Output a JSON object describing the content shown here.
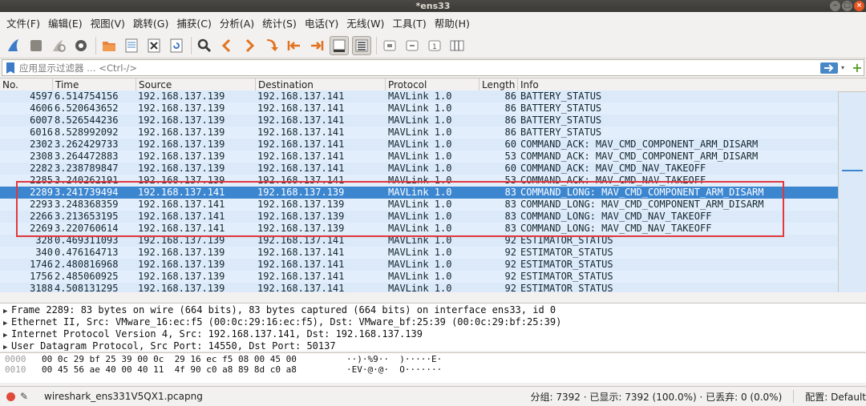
{
  "window": {
    "title": "*ens33"
  },
  "menu": [
    "文件(F)",
    "编辑(E)",
    "视图(V)",
    "跳转(G)",
    "捕获(C)",
    "分析(A)",
    "统计(S)",
    "电话(Y)",
    "无线(W)",
    "工具(T)",
    "帮助(H)"
  ],
  "toolbar_icons": [
    "shark-fin-start-icon",
    "stop-square-icon",
    "restart-fin-icon",
    "gear-options-icon",
    "open-folder-icon",
    "save-file-icon",
    "close-file-icon",
    "reload-icon",
    "find-magnifier-icon",
    "back-arrow-icon",
    "forward-arrow-icon",
    "goto-packet-icon",
    "first-packet-icon",
    "last-packet-icon",
    "autoscroll-icon",
    "colorize-icon",
    "zoom-in-icon",
    "zoom-out-icon",
    "normal-size-icon",
    "resize-columns-icon"
  ],
  "filter": {
    "placeholder": "应用显示过滤器 … <Ctrl-/>"
  },
  "columns": {
    "no": "No.",
    "time": "Time",
    "source": "Source",
    "destination": "Destination",
    "protocol": "Protocol",
    "length": "Length",
    "info": "Info"
  },
  "packets": [
    {
      "no": "4597",
      "time": "6.514754156",
      "source": "192.168.137.139",
      "destination": "192.168.137.141",
      "protocol": "MAVLink 1.0",
      "length": "86",
      "info": "BATTERY_STATUS"
    },
    {
      "no": "4606",
      "time": "6.520643652",
      "source": "192.168.137.139",
      "destination": "192.168.137.141",
      "protocol": "MAVLink 1.0",
      "length": "86",
      "info": "BATTERY_STATUS"
    },
    {
      "no": "6007",
      "time": "8.526544236",
      "source": "192.168.137.139",
      "destination": "192.168.137.141",
      "protocol": "MAVLink 1.0",
      "length": "86",
      "info": "BATTERY_STATUS"
    },
    {
      "no": "6016",
      "time": "8.528992092",
      "source": "192.168.137.139",
      "destination": "192.168.137.141",
      "protocol": "MAVLink 1.0",
      "length": "86",
      "info": "BATTERY_STATUS"
    },
    {
      "no": "2302",
      "time": "3.262429733",
      "source": "192.168.137.139",
      "destination": "192.168.137.141",
      "protocol": "MAVLink 1.0",
      "length": "60",
      "info": "COMMAND_ACK: MAV_CMD_COMPONENT_ARM_DISARM"
    },
    {
      "no": "2308",
      "time": "3.264472883",
      "source": "192.168.137.139",
      "destination": "192.168.137.141",
      "protocol": "MAVLink 1.0",
      "length": "53",
      "info": "COMMAND_ACK: MAV_CMD_COMPONENT_ARM_DISARM"
    },
    {
      "no": "2282",
      "time": "3.238789847",
      "source": "192.168.137.139",
      "destination": "192.168.137.141",
      "protocol": "MAVLink 1.0",
      "length": "60",
      "info": "COMMAND_ACK: MAV_CMD_NAV_TAKEOFF"
    },
    {
      "no": "2285",
      "time": "3.240262191",
      "source": "192.168.137.139",
      "destination": "192.168.137.141",
      "protocol": "MAVLink 1.0",
      "length": "53",
      "info": "COMMAND_ACK: MAV_CMD_NAV_TAKEOFF"
    },
    {
      "no": "2289",
      "time": "3.241739494",
      "source": "192.168.137.141",
      "destination": "192.168.137.139",
      "protocol": "MAVLink 1.0",
      "length": "83",
      "info": "COMMAND_LONG: MAV_CMD_COMPONENT_ARM_DISARM",
      "selected": true
    },
    {
      "no": "2293",
      "time": "3.248368359",
      "source": "192.168.137.141",
      "destination": "192.168.137.139",
      "protocol": "MAVLink 1.0",
      "length": "83",
      "info": "COMMAND_LONG: MAV_CMD_COMPONENT_ARM_DISARM"
    },
    {
      "no": "2266",
      "time": "3.213653195",
      "source": "192.168.137.141",
      "destination": "192.168.137.139",
      "protocol": "MAVLink 1.0",
      "length": "83",
      "info": "COMMAND_LONG: MAV_CMD_NAV_TAKEOFF"
    },
    {
      "no": "2269",
      "time": "3.220760614",
      "source": "192.168.137.141",
      "destination": "192.168.137.139",
      "protocol": "MAVLink 1.0",
      "length": "83",
      "info": "COMMAND_LONG: MAV_CMD_NAV_TAKEOFF"
    },
    {
      "no": "328",
      "time": "0.469311093",
      "source": "192.168.137.139",
      "destination": "192.168.137.141",
      "protocol": "MAVLink 1.0",
      "length": "92",
      "info": "ESTIMATOR_STATUS"
    },
    {
      "no": "340",
      "time": "0.476164713",
      "source": "192.168.137.139",
      "destination": "192.168.137.141",
      "protocol": "MAVLink 1.0",
      "length": "92",
      "info": "ESTIMATOR_STATUS"
    },
    {
      "no": "1746",
      "time": "2.480816968",
      "source": "192.168.137.139",
      "destination": "192.168.137.141",
      "protocol": "MAVLink 1.0",
      "length": "92",
      "info": "ESTIMATOR_STATUS"
    },
    {
      "no": "1756",
      "time": "2.485060925",
      "source": "192.168.137.139",
      "destination": "192.168.137.141",
      "protocol": "MAVLink 1.0",
      "length": "92",
      "info": "ESTIMATOR_STATUS"
    },
    {
      "no": "3188",
      "time": "4.508131295",
      "source": "192.168.137.139",
      "destination": "192.168.137.141",
      "protocol": "MAVLink 1.0",
      "length": "92",
      "info": "ESTIMATOR_STATUS"
    }
  ],
  "details": [
    "Frame 2289: 83 bytes on wire (664 bits), 83 bytes captured (664 bits) on interface ens33, id 0",
    "Ethernet II, Src: VMware_16:ec:f5 (00:0c:29:16:ec:f5), Dst: VMware_bf:25:39 (00:0c:29:bf:25:39)",
    "Internet Protocol Version 4, Src: 192.168.137.141, Dst: 192.168.137.139",
    "User Datagram Protocol, Src Port: 14550, Dst Port: 50137"
  ],
  "bytes": [
    {
      "offset": "0000",
      "hex": "00 0c 29 bf 25 39 00 0c  29 16 ec f5 08 00 45 00",
      "ascii": "··)·%9··  )·····E·"
    },
    {
      "offset": "0010",
      "hex": "00 45 56 ae 40 00 40 11  4f 90 c0 a8 89 8d c0 a8",
      "ascii": "·EV·@·@·  O·······"
    }
  ],
  "status": {
    "file": "wireshark_ens331V5QX1.pcapng",
    "stats": "分组: 7392 · 已显示: 7392 (100.0%) · 已丢弃: 0 (0.0%)",
    "profile": "配置: Default"
  },
  "colors": {
    "row_bg": "#dbe9f9",
    "selected_bg": "#3c86d0",
    "highlight_border": "#e2383c",
    "title_bar": "#3b3a36"
  }
}
